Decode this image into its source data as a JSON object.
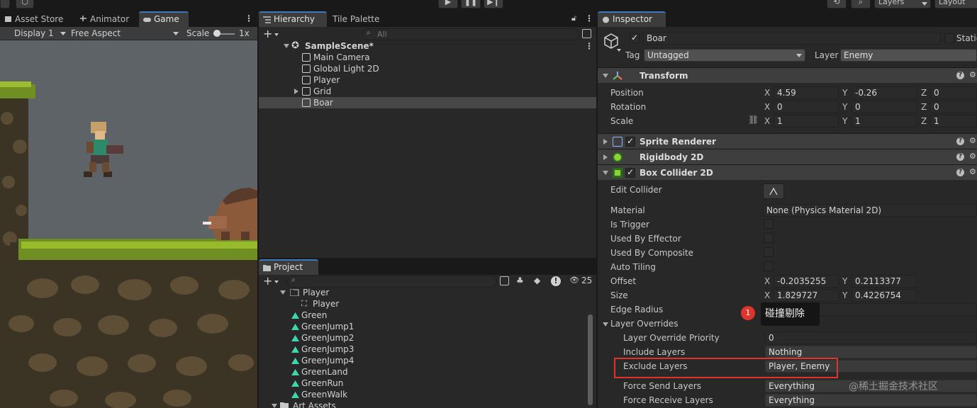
{
  "toolbar": {
    "layers_label": "Layers",
    "layout_label": "Layout"
  },
  "game_panel": {
    "tabs": [
      {
        "label": "Asset Store"
      },
      {
        "label": "Animator"
      },
      {
        "label": "Game"
      }
    ],
    "display": "Display 1",
    "aspect": "Free Aspect",
    "scale_label": "Scale",
    "scale_value": "1x",
    "scale_slider_value": 0.0
  },
  "hierarchy": {
    "tabs": [
      {
        "label": "Hierarchy"
      },
      {
        "label": "Tile Palette"
      }
    ],
    "search_placeholder": "All",
    "scene": "SampleScene*",
    "items": [
      {
        "label": "Main Camera"
      },
      {
        "label": "Global Light 2D"
      },
      {
        "label": "Player"
      },
      {
        "label": "Grid"
      },
      {
        "label": "Boar"
      }
    ]
  },
  "project": {
    "tab": "Project",
    "hidden_count": "25",
    "folder": "Player",
    "items": [
      {
        "label": "Player"
      },
      {
        "label": "Green"
      },
      {
        "label": "GreenJump1"
      },
      {
        "label": "GreenJump2"
      },
      {
        "label": "GreenJump3"
      },
      {
        "label": "GreenJump4"
      },
      {
        "label": "GreenLand"
      },
      {
        "label": "GreenRun"
      },
      {
        "label": "GreenWalk"
      },
      {
        "label": "Art Assets"
      }
    ]
  },
  "inspector": {
    "tab": "Inspector",
    "object_name": "Boar",
    "static_label": "Static",
    "tag_label": "Tag",
    "tag_value": "Untagged",
    "layer_label": "Layer",
    "layer_value": "Enemy",
    "transform": {
      "title": "Transform",
      "position_label": "Position",
      "position": {
        "x": "4.59",
        "y": "-0.26",
        "z": "0"
      },
      "rotation_label": "Rotation",
      "rotation": {
        "x": "0",
        "y": "0",
        "z": "0"
      },
      "scale_label": "Scale",
      "scale": {
        "x": "1",
        "y": "1",
        "z": "1"
      }
    },
    "sprite_renderer": "Sprite Renderer",
    "rigidbody": "Rigidbody 2D",
    "box_collider": {
      "title": "Box Collider 2D",
      "edit_collider": "Edit Collider",
      "material_label": "Material",
      "material_value": "None (Physics Material 2D)",
      "is_trigger": "Is Trigger",
      "used_by_effector": "Used By Effector",
      "used_by_composite": "Used By Composite",
      "auto_tiling": "Auto Tiling",
      "offset_label": "Offset",
      "offset": {
        "x": "-0.2035255",
        "y": "0.2113377"
      },
      "size_label": "Size",
      "size": {
        "x": "1.829727",
        "y": "0.4226754"
      },
      "edge_radius": "Edge Radius",
      "layer_overrides": "Layer Overrides",
      "override_priority_label": "Layer Override Priority",
      "override_priority": "0",
      "include_label": "Include Layers",
      "include_value": "Nothing",
      "exclude_label": "Exclude Layers",
      "exclude_value": "Player, Enemy",
      "force_send_label": "Force Send Layers",
      "force_send_value": "Everything",
      "force_receive_label": "Force Receive Layers",
      "force_receive_value": "Everything"
    },
    "annotation_number": "1",
    "annotation_text": "碰撞剔除"
  },
  "axis": {
    "x": "X",
    "y": "Y",
    "z": "Z"
  },
  "watermark": "@稀土掘金技术社区",
  "colors": {
    "accent": "#3a79bb",
    "highlight_box": "#e0332c",
    "selection": "#474747"
  }
}
